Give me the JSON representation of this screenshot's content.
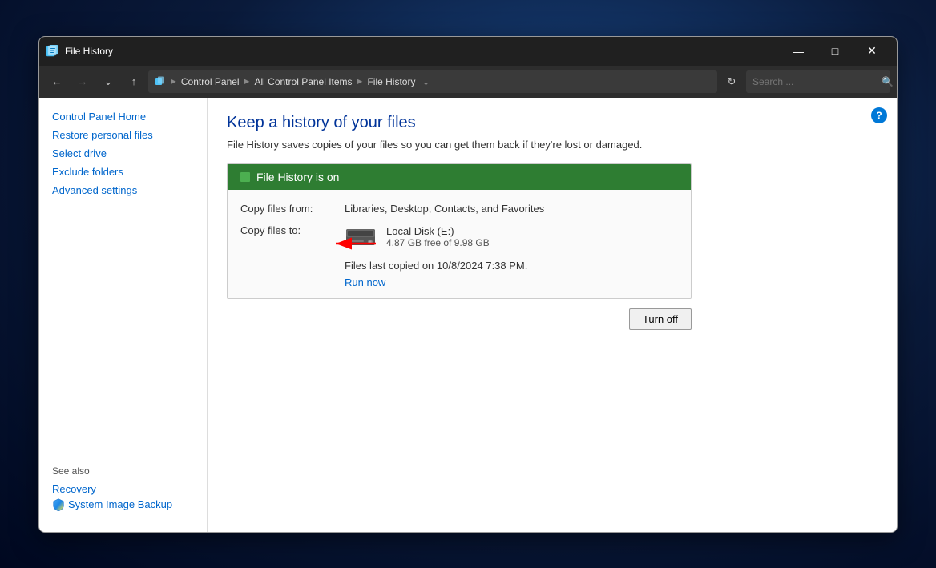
{
  "window": {
    "title": "File History",
    "icon": "file-history-icon"
  },
  "titlebar": {
    "title": "File History",
    "minimize_label": "—",
    "maximize_label": "□",
    "close_label": "✕"
  },
  "addressbar": {
    "back_tooltip": "Back",
    "forward_tooltip": "Forward",
    "recent_tooltip": "Recent locations",
    "up_tooltip": "Up",
    "refresh_tooltip": "Refresh",
    "breadcrumb": {
      "items": [
        {
          "label": "Control Panel"
        },
        {
          "label": "All Control Panel Items"
        },
        {
          "label": "File History"
        }
      ]
    },
    "search_placeholder": "Search ...",
    "search_icon": "search-icon"
  },
  "sidebar": {
    "links": [
      {
        "label": "Control Panel Home",
        "id": "control-panel-home"
      },
      {
        "label": "Restore personal files",
        "id": "restore-personal-files"
      },
      {
        "label": "Select drive",
        "id": "select-drive"
      },
      {
        "label": "Exclude folders",
        "id": "exclude-folders"
      },
      {
        "label": "Advanced settings",
        "id": "advanced-settings"
      }
    ],
    "see_also": {
      "label": "See also",
      "items": [
        {
          "label": "Recovery",
          "id": "recovery",
          "icon": null
        },
        {
          "label": "System Image Backup",
          "id": "system-image-backup",
          "icon": "shield-icon"
        }
      ]
    }
  },
  "content": {
    "help_label": "?",
    "title": "Keep a history of your files",
    "description": "File History saves copies of your files so you can get them back if they're lost or damaged.",
    "status_box": {
      "status": "on",
      "status_label": "File History is on",
      "copy_files_from_label": "Copy files from:",
      "copy_files_from_value": "Libraries, Desktop, Contacts, and Favorites",
      "copy_files_to_label": "Copy files to:",
      "drive_name": "Local Disk (E:)",
      "drive_space": "4.87 GB free of 9.98 GB",
      "last_copied_label": "Files last copied on 10/8/2024 7:38 PM.",
      "run_now_label": "Run now",
      "turn_off_label": "Turn off"
    }
  }
}
